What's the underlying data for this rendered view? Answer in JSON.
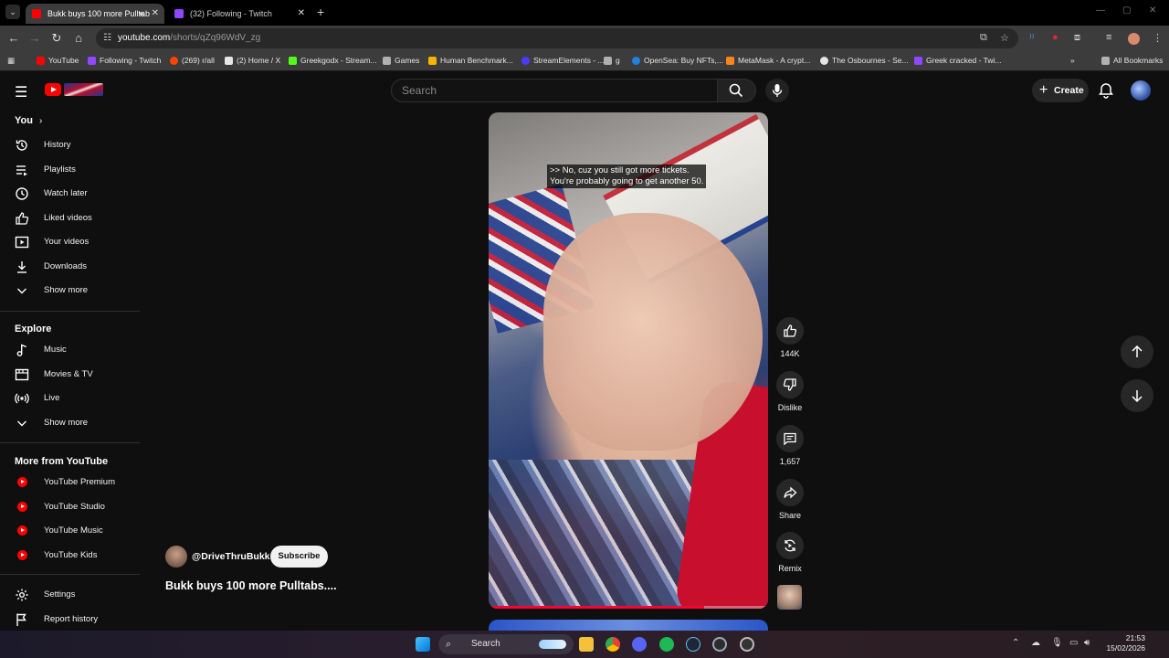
{
  "browser": {
    "tabs": [
      {
        "title": "Bukk buys 100 more Pulltab",
        "active": true,
        "favicon_color": "#ff0000"
      },
      {
        "title": "(32) Following - Twitch",
        "active": false,
        "favicon_color": "#9146ff"
      }
    ],
    "url": {
      "host": "youtube.com",
      "path": "/shorts/qZq96WdV_zg"
    },
    "bookmarks": [
      {
        "label": "YouTube",
        "icon_color": "#ff0000"
      },
      {
        "label": "Following - Twitch",
        "icon_color": "#9146ff"
      },
      {
        "label": "(269) r/all",
        "icon_color": "#ff4500"
      },
      {
        "label": "(2) Home / X",
        "icon_color": "#e6e6e6"
      },
      {
        "label": "Greekgodx - Stream...",
        "icon_color": "#53fc18"
      },
      {
        "label": "Games",
        "icon_color": "#b0b0b0"
      },
      {
        "label": "Human Benchmark...",
        "icon_color": "#f5b400"
      },
      {
        "label": "StreamElements - ...",
        "icon_color": "#4a3cff"
      },
      {
        "label": "g",
        "icon_color": "#b0b0b0"
      },
      {
        "label": "OpenSea: Buy NFTs,...",
        "icon_color": "#2081e2"
      },
      {
        "label": "MetaMask - A crypt...",
        "icon_color": "#f6851b"
      },
      {
        "label": "The Osbournes - Se...",
        "icon_color": "#e6e6e6"
      },
      {
        "label": "Greek cracked - Twi...",
        "icon_color": "#9146ff"
      },
      {
        "label": "All Bookmarks",
        "icon_color": "#b0b0b0"
      }
    ]
  },
  "header": {
    "search_placeholder": "Search",
    "create_label": "Create"
  },
  "sidebar": {
    "you_heading": "You",
    "you_items": [
      {
        "label": "History",
        "icon": "history-icon"
      },
      {
        "label": "Playlists",
        "icon": "playlists-icon"
      },
      {
        "label": "Watch later",
        "icon": "watch-later-icon"
      },
      {
        "label": "Liked videos",
        "icon": "liked-videos-icon"
      },
      {
        "label": "Your videos",
        "icon": "your-videos-icon"
      },
      {
        "label": "Downloads",
        "icon": "downloads-icon"
      },
      {
        "label": "Show more",
        "icon": "chevron-down-icon"
      }
    ],
    "explore_heading": "Explore",
    "explore_items": [
      {
        "label": "Music",
        "icon": "music-icon"
      },
      {
        "label": "Movies & TV",
        "icon": "movies-icon"
      },
      {
        "label": "Live",
        "icon": "live-icon"
      },
      {
        "label": "Show more",
        "icon": "chevron-down-icon"
      }
    ],
    "more_heading": "More from YouTube",
    "more_items": [
      {
        "label": "YouTube Premium"
      },
      {
        "label": "YouTube Studio"
      },
      {
        "label": "YouTube Music"
      },
      {
        "label": "YouTube Kids"
      }
    ],
    "bottom_items": [
      {
        "label": "Settings",
        "icon": "gear-icon"
      },
      {
        "label": "Report history",
        "icon": "flag-icon"
      }
    ]
  },
  "short": {
    "caption_line1": ">> No, cuz you still got more tickets.",
    "caption_line2": "You're probably going to get another 50.",
    "channel": "@DriveThruBukk",
    "subscribe_label": "Subscribe",
    "title": "Bukk buys 100 more Pulltabs....",
    "progress": 0.77
  },
  "actions": {
    "likes": "144K",
    "dislike": "Dislike",
    "comments": "1,657",
    "share": "Share",
    "remix": "Remix"
  },
  "taskbar": {
    "search_label": "Search",
    "time": "21:53",
    "date": "15/02/2026"
  },
  "colors": {
    "accent": "#ff0000",
    "bg": "#0f0f0f",
    "chip": "#272727"
  }
}
